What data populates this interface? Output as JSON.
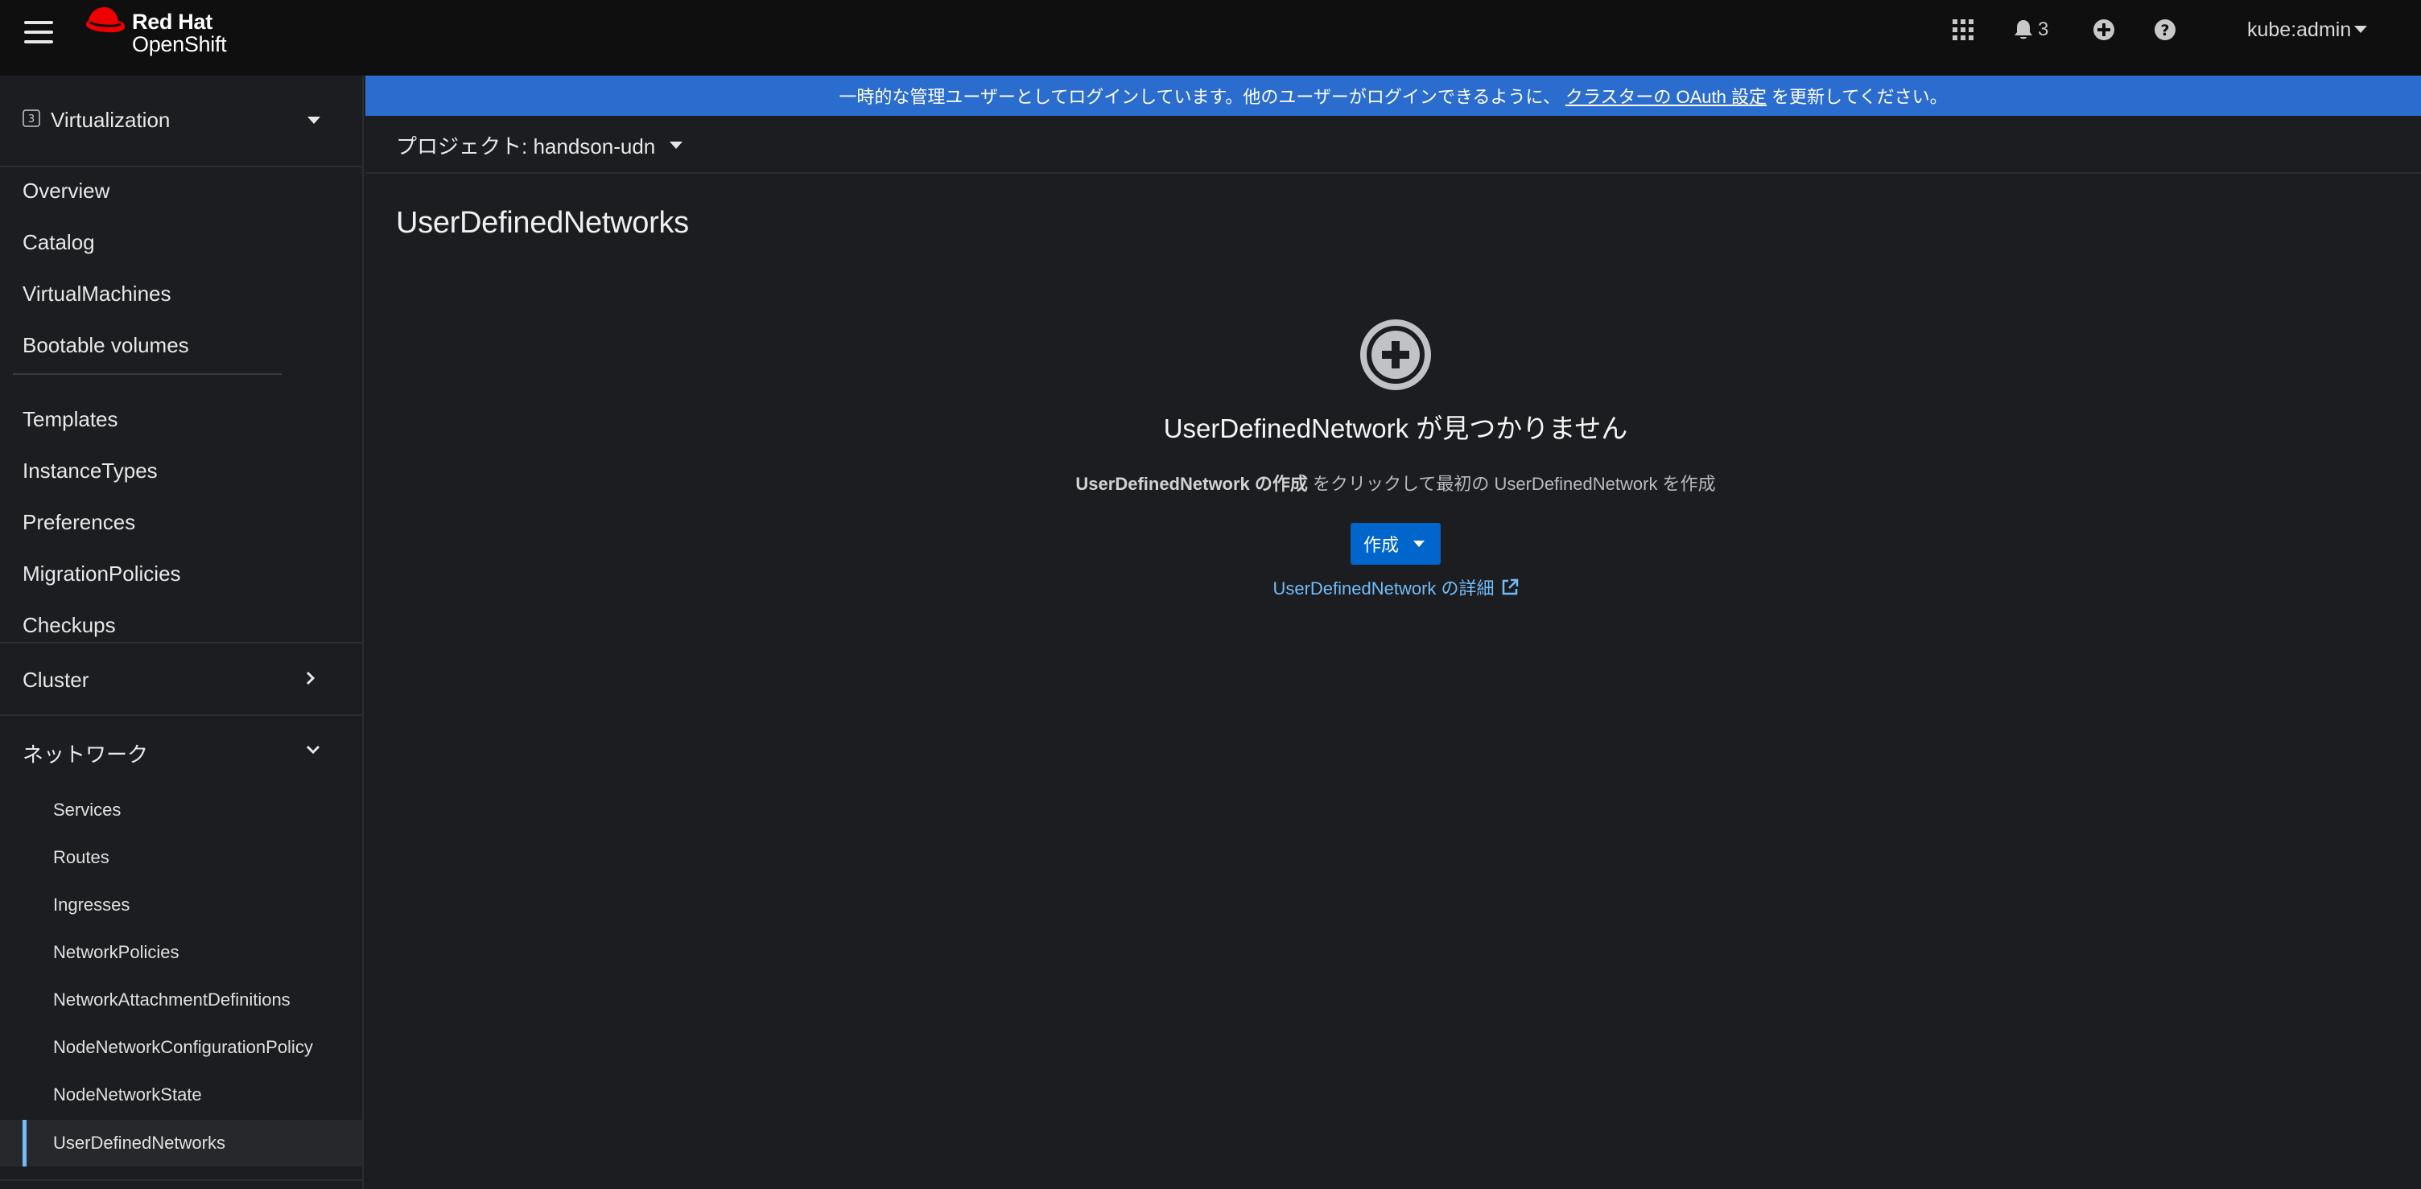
{
  "masthead": {
    "brand_line1": "Red Hat",
    "brand_line2": "OpenShift",
    "notification_count": "3",
    "user": "kube:admin"
  },
  "sidebar": {
    "perspective": "Virtualization",
    "items": [
      "Overview",
      "Catalog",
      "VirtualMachines",
      "Bootable volumes"
    ],
    "items2": [
      "Templates",
      "InstanceTypes",
      "Preferences",
      "MigrationPolicies",
      "Checkups"
    ],
    "cluster": "Cluster",
    "network": "ネットワーク",
    "network_items": [
      "Services",
      "Routes",
      "Ingresses",
      "NetworkPolicies",
      "NetworkAttachmentDefinitions",
      "NodeNetworkConfigurationPolicy",
      "NodeNetworkState",
      "UserDefinedNetworks"
    ]
  },
  "banner": {
    "text_before": "一時的な管理ユーザーとしてログインしています。他のユーザーがログインできるように、",
    "link": "クラスターの OAuth 設定",
    "text_after": "を更新してください。"
  },
  "project": {
    "label": "プロジェクト: handson-udn"
  },
  "main": {
    "title": "UserDefinedNetworks",
    "empty_title": "UserDefinedNetwork が見つかりません",
    "empty_body_bold": "UserDefinedNetwork の作成",
    "empty_body_rest": " をクリックして最初の UserDefinedNetwork を作成",
    "create_button": "作成",
    "learn_more": "UserDefinedNetwork の詳細"
  },
  "colors": {
    "masthead_bg": "#0f0f0f",
    "banner_bg": "#2b6ccf",
    "primary_button": "#0066cc",
    "link": "#73bcf7",
    "active_nav_marker": "#73bcf7",
    "brand_red": "#ee0000"
  }
}
